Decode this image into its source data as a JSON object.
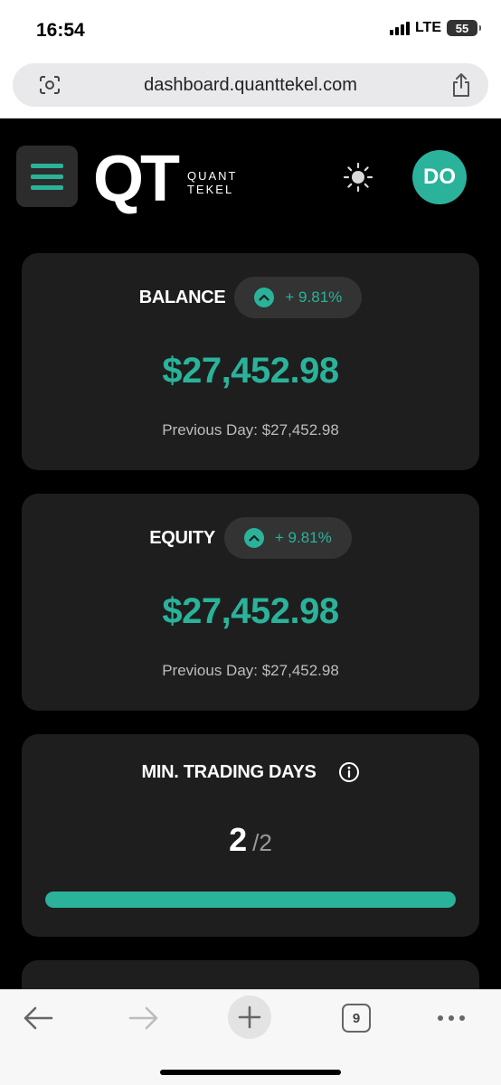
{
  "status": {
    "time": "16:54",
    "network": "LTE",
    "battery": "55"
  },
  "browser": {
    "url": "dashboard.quanttekel.com",
    "tab_count": "9"
  },
  "header": {
    "logo_main": "QT",
    "logo_line1": "QUANT",
    "logo_line2": "TEKEL",
    "avatar_initials": "DO"
  },
  "balance": {
    "title": "BALANCE",
    "change": "+ 9.81%",
    "amount": "$27,452.98",
    "previous": "Previous Day: $27,452.98"
  },
  "equity": {
    "title": "EQUITY",
    "change": "+ 9.81%",
    "amount": "$27,452.98",
    "previous": "Previous Day: $27,452.98"
  },
  "trading_days": {
    "title": "MIN. TRADING DAYS",
    "current": "2",
    "total": "/2",
    "progress": 1.0
  },
  "colors": {
    "accent": "#2ab39a",
    "card": "#1e1e1e",
    "background": "#000000"
  }
}
